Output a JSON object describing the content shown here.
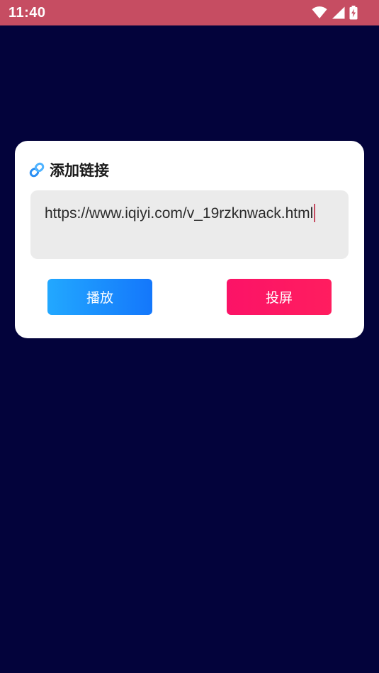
{
  "status_bar": {
    "time": "11:40",
    "icons": [
      "wifi-icon",
      "signal-icon",
      "battery-charging-icon"
    ],
    "background": "#c64d62"
  },
  "dialog": {
    "icon": "link-icon",
    "title": "添加链接",
    "url_value": "https://www.iqiyi.com/v_19rzknwack.html",
    "buttons": {
      "play_label": "播放",
      "cast_label": "投屏"
    }
  },
  "colors": {
    "page_background": "#03033b",
    "play_button": "#1a8cff",
    "cast_button": "#fd1864",
    "input_background": "#ebebeb",
    "caret": "#c64d62"
  }
}
